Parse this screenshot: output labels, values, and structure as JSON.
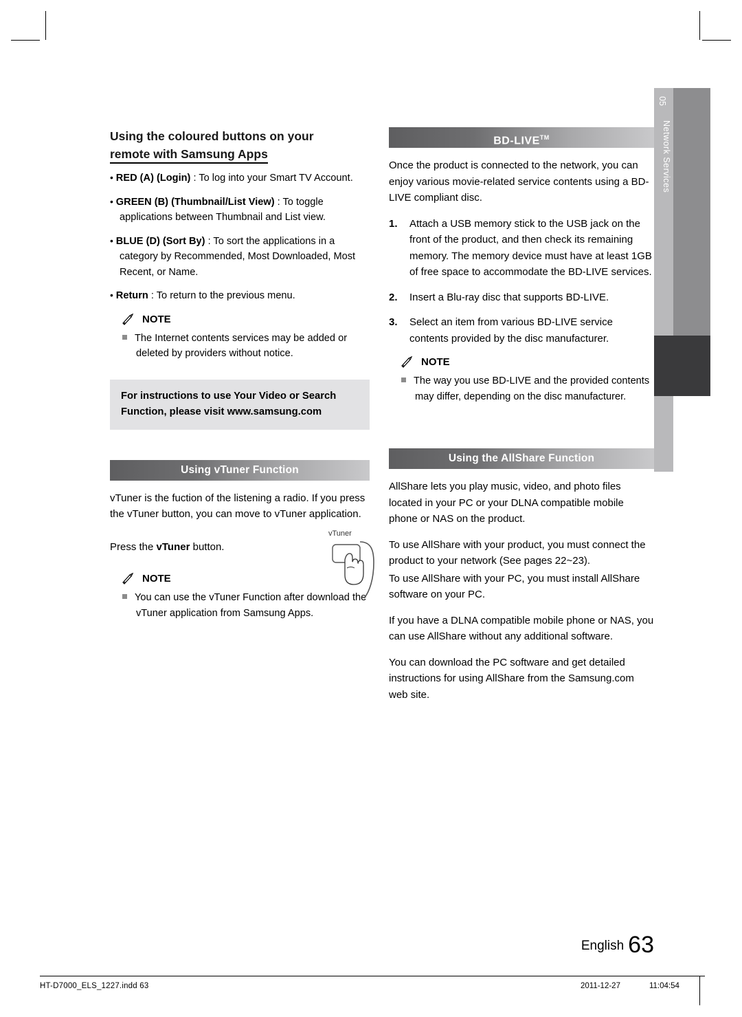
{
  "page": {
    "number": "63",
    "language_label": "English",
    "footer_file": "HT-D7000_ELS_1227.indd   63",
    "footer_date": "2011-12-27",
    "footer_time": "11:04:54",
    "side_tab_chapter": "05",
    "side_tab_label": "Network Services"
  },
  "left": {
    "heading_line1": "Using the coloured buttons on your",
    "heading_line2": "remote with Samsung Apps",
    "bullets": [
      {
        "label": "RED (A) (Login)",
        "text": " : To log into your Smart TV Account."
      },
      {
        "label": "GREEN (B) (Thumbnail/List View)",
        "text": " : To toggle applications between Thumbnail and List view."
      },
      {
        "label": "BLUE (D) (Sort By)",
        "text": " : To sort the applications in a category by Recommended, Most Downloaded, Most Recent, or Name."
      },
      {
        "label": "Return",
        "text": " : To return to the previous menu."
      }
    ],
    "note_label": "NOTE",
    "notes": [
      "The Internet contents services may be added or deleted by providers without notice."
    ],
    "infobox_line1": "For instructions to use Your Video or Search",
    "infobox_line2": "Function, please visit www.samsung.com",
    "vtuner": {
      "bar_title": "Using vTuner Function",
      "paragraph": "vTuner is the fuction of the listening a radio. If you press the vTuner button, you can move to vTuner application.",
      "press_prefix": "Press the ",
      "press_bold": "vTuner",
      "press_suffix": " button.",
      "button_label": "vTuner",
      "note_label": "NOTE",
      "notes": [
        "You can use the vTuner Function after download the vTuner application from Samsung Apps."
      ]
    }
  },
  "right": {
    "bdlive": {
      "bar_title": "BD-LIVE",
      "bar_title_tm": "TM",
      "intro": "Once the product is connected to the network, you can enjoy various movie-related service contents using a BD-LIVE compliant disc.",
      "steps": [
        {
          "num": "1.",
          "text": "Attach a USB memory stick to the USB jack on the front of the product, and then check its remaining memory. The memory device must have at least 1GB of free space to accommodate the BD-LIVE services."
        },
        {
          "num": "2.",
          "text": "Insert a Blu-ray disc that supports BD-LIVE."
        },
        {
          "num": "3.",
          "text": "Select an item from various BD-LIVE service contents provided by the disc manufacturer."
        }
      ],
      "note_label": "NOTE",
      "notes": [
        "The way you use BD-LIVE and the provided contents may differ, depending on the disc manufacturer."
      ]
    },
    "allshare": {
      "bar_title": "Using the AllShare Function",
      "paragraphs": [
        "AllShare lets you play music, video, and photo files located in your PC or your DLNA compatible mobile phone or NAS on the product.",
        "To use AllShare with your product, you must connect the product to your network (See pages 22~23).",
        "To use AllShare with your PC, you must install AllShare software on your PC.",
        "If you have a DLNA compatible mobile phone or NAS, you can use AllShare without any additional software.",
        "You can download the PC software and get detailed instructions for using AllShare from the Samsung.com web site."
      ]
    }
  }
}
